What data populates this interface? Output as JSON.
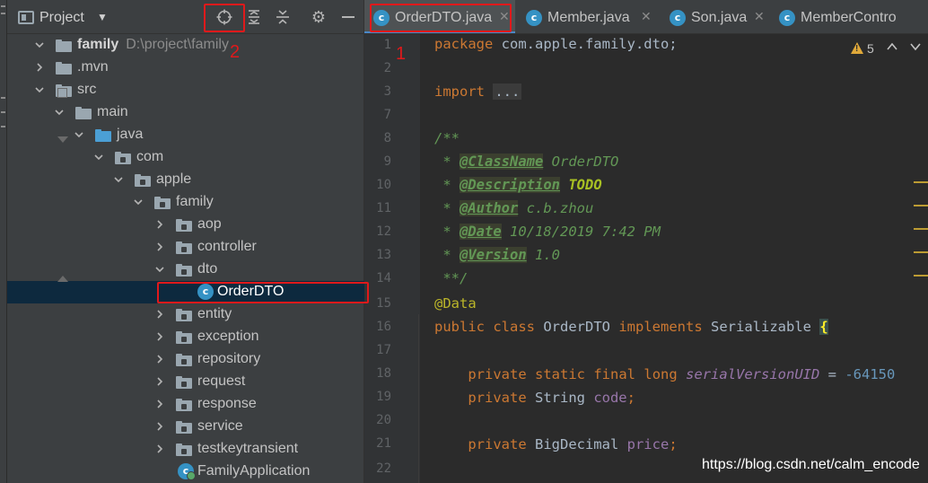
{
  "project_panel": {
    "title": "Project",
    "tree": [
      {
        "label": "family",
        "path": "D:\\project\\family",
        "expanded": true,
        "icon": "module-folder-icon",
        "bold": true
      },
      {
        "label": ".mvn",
        "expanded": false,
        "icon": "folder-icon"
      },
      {
        "label": "src",
        "expanded": true,
        "icon": "folder-icon"
      },
      {
        "label": "main",
        "expanded": true,
        "icon": "folder-icon"
      },
      {
        "label": "java",
        "expanded": true,
        "icon": "source-folder-icon"
      },
      {
        "label": "com",
        "expanded": true,
        "icon": "package-icon"
      },
      {
        "label": "apple",
        "expanded": true,
        "icon": "package-icon"
      },
      {
        "label": "family",
        "expanded": true,
        "icon": "package-icon"
      },
      {
        "label": "aop",
        "expanded": false,
        "icon": "package-icon"
      },
      {
        "label": "controller",
        "expanded": false,
        "icon": "package-icon"
      },
      {
        "label": "dto",
        "expanded": true,
        "icon": "package-icon"
      },
      {
        "label": "OrderDTO",
        "icon": "class-icon",
        "selected": true
      },
      {
        "label": "entity",
        "expanded": false,
        "icon": "package-icon"
      },
      {
        "label": "exception",
        "expanded": false,
        "icon": "package-icon"
      },
      {
        "label": "repository",
        "expanded": false,
        "icon": "package-icon"
      },
      {
        "label": "request",
        "expanded": false,
        "icon": "package-icon"
      },
      {
        "label": "response",
        "expanded": false,
        "icon": "package-icon"
      },
      {
        "label": "service",
        "expanded": false,
        "icon": "package-icon"
      },
      {
        "label": "testkeytransient",
        "expanded": false,
        "icon": "package-icon"
      },
      {
        "label": "FamilyApplication",
        "icon": "spring-app-class-icon"
      }
    ]
  },
  "tabs": [
    {
      "label": "OrderDTO.java",
      "active": true
    },
    {
      "label": "Member.java",
      "active": false
    },
    {
      "label": "Son.java",
      "active": false
    },
    {
      "label": "MemberContro",
      "active": false
    }
  ],
  "gutter": {
    "line_numbers": [
      "1",
      "2",
      "3",
      "7",
      "8",
      "9",
      "10",
      "11",
      "12",
      "13",
      "14",
      "15",
      "16",
      "17",
      "18",
      "19",
      "20",
      "21",
      "22"
    ]
  },
  "code": {
    "package_kw": "package",
    "package_name": " com.apple.family.dto;",
    "import_kw": "import",
    "import_fold": "...",
    "doc_open": "/**",
    "doc_star": " * ",
    "tag_classname": "@ClassName",
    "val_classname": " OrderDTO",
    "tag_description": "@Description",
    "val_description": "TODO",
    "tag_author": "@Author",
    "val_author": " c.b.zhou",
    "tag_date": "@Date",
    "val_date": " 10/18/2019 7:42 PM",
    "tag_version": "@Version",
    "val_version": " 1.0",
    "doc_close": " **/",
    "annotation": "@Data",
    "kw_public": "public",
    "kw_class": "class",
    "class_name": " OrderDTO ",
    "kw_implements": "implements",
    "iface": " Serializable ",
    "open_brace": "{",
    "kw_private": "private",
    "kw_static": "static",
    "kw_final": "final",
    "kw_long": "long",
    "svuid": "serialVersionUID",
    "svuid_eq": " = ",
    "svuid_val": "-64150",
    "type_string": " String ",
    "field_code": "code",
    "type_bigdecimal": " BigDecimal ",
    "field_price": "price",
    "semi": ";"
  },
  "inspection": {
    "warning_count": "5",
    "icon": "warning-icon"
  },
  "annotations": {
    "label_1": "1",
    "label_2": "2"
  },
  "watermark": "https://blog.csdn.net/calm_encode",
  "colors": {
    "highlight_box": "#e0191b",
    "class_icon": "#3592c4",
    "selection": "#0d293e"
  }
}
